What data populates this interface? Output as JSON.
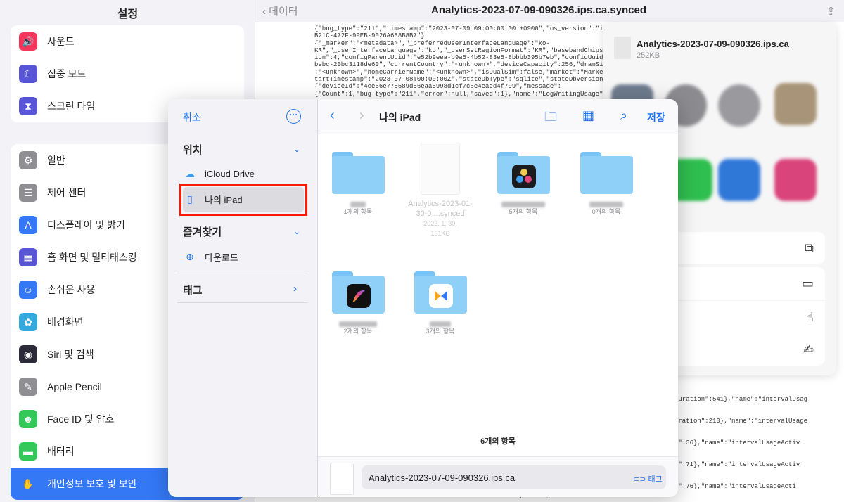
{
  "settings": {
    "title": "설정",
    "group1": [
      {
        "label": "사운드",
        "color": "#f5365c",
        "icon": "speaker-icon",
        "glyph": "🔊"
      },
      {
        "label": "집중 모드",
        "color": "#5856d6",
        "icon": "moon-icon",
        "glyph": "☾"
      },
      {
        "label": "스크린 타임",
        "color": "#5856d6",
        "icon": "hourglass-icon",
        "glyph": "⧗"
      }
    ],
    "group2": [
      {
        "label": "일반",
        "color": "#8e8e93",
        "icon": "gear-icon",
        "glyph": "⚙"
      },
      {
        "label": "제어 센터",
        "color": "#8e8e93",
        "icon": "toggles-icon",
        "glyph": "☰"
      },
      {
        "label": "디스플레이 및 밝기",
        "color": "#3478f6",
        "icon": "display-icon",
        "glyph": "A"
      },
      {
        "label": "홈 화면 및 멀티태스킹",
        "color": "#5856d6",
        "icon": "grid-icon",
        "glyph": "▦"
      },
      {
        "label": "손쉬운 사용",
        "color": "#3478f6",
        "icon": "accessibility-icon",
        "glyph": "☺"
      },
      {
        "label": "배경화면",
        "color": "#34aadc",
        "icon": "flower-icon",
        "glyph": "✿"
      },
      {
        "label": "Siri 및 검색",
        "color": "#2b2b3a",
        "icon": "siri-icon",
        "glyph": "◉"
      },
      {
        "label": "Apple Pencil",
        "color": "#8e8e93",
        "icon": "pencil-icon",
        "glyph": "✎"
      },
      {
        "label": "Face ID 및 암호",
        "color": "#34c759",
        "icon": "faceid-icon",
        "glyph": "☻"
      },
      {
        "label": "배터리",
        "color": "#34c759",
        "icon": "battery-icon",
        "glyph": "▬"
      },
      {
        "label": "개인정보 보호 및 보안",
        "color": "#3478f6",
        "icon": "hand-icon",
        "glyph": "✋"
      }
    ]
  },
  "viewer": {
    "back_label": "데이터",
    "title": "Analytics-2023-07-09-090326.ips.ca.synced",
    "json_lines": [
      "{\"bug_type\":\"211\",\"timestamp\":\"2023-07-09 09:00:00.00 +0900\",\"os_version\":\"iPhone OS 16.5",
      "B21C-472F-99EB-9026A688B8B7\"}",
      "{\"_marker\":\"<metadata>\",\"_preferredUserInterfaceLanguage\":\"ko-",
      "KR\",\"_userInterfaceLanguage\":\"ko\",\"_userSetRegionFormat\":\"KR\",\"basebandChipset\":\"<unknow",
      "ion\":4,\"configParentUuid\":\"e52b9eea-b9a5-4b52-83e5-8bbbb395b7eb\",\"configUuid\":\"600a2a",
      "bebc-20bc3118de60\",\"currentCountry\":\"<unknown>\",\"deviceCapacity\":256,\"dramSize\":3.5,\"hom",
      ":\"<unknown>\",\"homeCarrierName\":\"<unknown>\",\"isDualSim\":false,\"market\":\"MarketNA\",\"rollove",
      "tartTimestamp\":\"2023-07-08T00:00:00Z\",\"stateDbType\":\"sqlite\",\"stateDbVersion\":3,\"trialExper",
      "{\"deviceId\":\"4ce66e775589d56eaa5998d1cf7c8e4eaed4f799\",\"message\":",
      "{\"Count\":1,\"bug_type\":\"211\",\"error\":null,\"saved\":1},\"name\":\"LogWritingUsage\",\"sampling\":100.0,"
    ],
    "lower_lines": [
      "Duration\":541},\"name\":\"intervalUsag",
      "uration\":210},\"name\":\"intervalUsage",
      "n\":36},\"name\":\"intervalUsageActiv",
      "n\":71},\"name\":\"intervalUsageActiv",
      "n\":76},\"name\":\"intervalUsageActi"
    ],
    "footer_line": "{\"deviceId\":\"4ce66e775589d56eaa5998d1cf7c8e4eaed4f799\",\"message\":"
  },
  "share": {
    "file_name": "Analytics-2023-07-09-090326.ips.ca",
    "file_size": "252KB",
    "action_partial": "기"
  },
  "picker": {
    "cancel_label": "취소",
    "locations_header": "위치",
    "locations": [
      {
        "label": "iCloud Drive",
        "icon": "icloud-icon"
      },
      {
        "label": "나의 iPad",
        "icon": "ipad-icon"
      }
    ],
    "favorites_header": "즐겨찾기",
    "favorites": [
      {
        "label": "다운로드",
        "icon": "download-icon"
      }
    ],
    "tags_header": "태그",
    "location_title": "나의 iPad",
    "save_label": "저장",
    "items": [
      {
        "type": "folder",
        "count": "1개의 항목"
      },
      {
        "type": "file",
        "name": "Analytics-2023-01-30-0....synced",
        "date": "2023. 1. 30.",
        "size": "161KB"
      },
      {
        "type": "folder",
        "count": "5개의 항목",
        "badge": "resolve"
      },
      {
        "type": "folder",
        "count": "0개의 항목"
      },
      {
        "type": "folder",
        "count": "2개의 항목",
        "badge": "procreate"
      },
      {
        "type": "folder",
        "count": "3개의 항목",
        "badge": "infuse"
      }
    ],
    "items_total": "6개의 항목",
    "filename_value": "Analytics-2023-07-09-090326.ips.ca",
    "tag_label": "태그"
  }
}
